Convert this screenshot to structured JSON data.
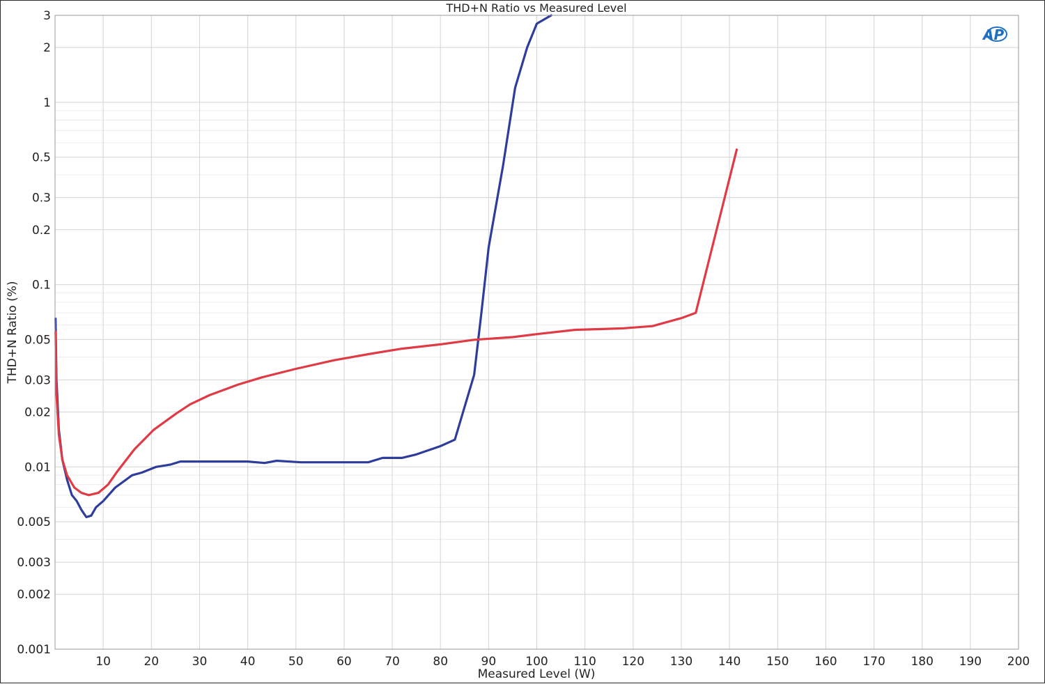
{
  "chart_data": {
    "type": "line",
    "title": "THD+N Ratio vs Measured Level",
    "xlabel": "Measured Level (W)",
    "ylabel": "THD+N Ratio (%)",
    "xlim": [
      0,
      200
    ],
    "ylim": [
      0.001,
      3
    ],
    "yscale": "log",
    "grid": true,
    "x_ticks": [
      10,
      20,
      30,
      40,
      50,
      60,
      70,
      80,
      90,
      100,
      110,
      120,
      130,
      140,
      150,
      160,
      170,
      180,
      190,
      200
    ],
    "y_ticks": [
      0.001,
      0.002,
      0.003,
      0.005,
      0.01,
      0.02,
      0.03,
      0.05,
      0.1,
      0.2,
      0.3,
      0.5,
      1,
      2,
      3
    ],
    "y_tick_labels": [
      "0.001",
      "0.002",
      "0.003",
      "0.005",
      "0.01",
      "0.02",
      "0.03",
      "0.05",
      "0.1",
      "0.2",
      "0.3",
      "0.5",
      "1",
      "2",
      "3"
    ],
    "series": [
      {
        "color": "#2e3c9c",
        "points": [
          [
            0.1,
            0.065
          ],
          [
            0.3,
            0.03
          ],
          [
            0.8,
            0.016
          ],
          [
            1.5,
            0.011
          ],
          [
            2.5,
            0.0085
          ],
          [
            3.5,
            0.007
          ],
          [
            4.5,
            0.0065
          ],
          [
            5.5,
            0.0058
          ],
          [
            6.5,
            0.0053
          ],
          [
            7.5,
            0.0054
          ],
          [
            8.5,
            0.006
          ],
          [
            10,
            0.0065
          ],
          [
            12.5,
            0.0077
          ],
          [
            16,
            0.009
          ],
          [
            18,
            0.0093
          ],
          [
            21,
            0.01
          ],
          [
            24,
            0.0103
          ],
          [
            26,
            0.0107
          ],
          [
            30,
            0.0107
          ],
          [
            35,
            0.0107
          ],
          [
            40,
            0.0107
          ],
          [
            43.5,
            0.0105
          ],
          [
            46,
            0.0108
          ],
          [
            51,
            0.0106
          ],
          [
            58,
            0.0106
          ],
          [
            65,
            0.0106
          ],
          [
            68,
            0.0112
          ],
          [
            72,
            0.0112
          ],
          [
            75,
            0.0117
          ],
          [
            80,
            0.013
          ],
          [
            83,
            0.0141
          ],
          [
            87,
            0.032
          ],
          [
            88.5,
            0.07
          ],
          [
            90,
            0.16
          ],
          [
            93,
            0.45
          ],
          [
            95.5,
            1.2
          ],
          [
            98,
            2.0
          ],
          [
            100,
            2.7
          ],
          [
            103,
            3.0
          ]
        ]
      },
      {
        "color": "#e03a44",
        "points": [
          [
            0.1,
            0.055
          ],
          [
            0.3,
            0.025
          ],
          [
            0.8,
            0.015
          ],
          [
            1.5,
            0.011
          ],
          [
            2.5,
            0.009
          ],
          [
            4,
            0.0077
          ],
          [
            5.5,
            0.0072
          ],
          [
            7,
            0.007
          ],
          [
            9,
            0.0072
          ],
          [
            11,
            0.008
          ],
          [
            13,
            0.0095
          ],
          [
            16.5,
            0.0125
          ],
          [
            20.5,
            0.016
          ],
          [
            25,
            0.0195
          ],
          [
            28,
            0.022
          ],
          [
            32,
            0.0247
          ],
          [
            38,
            0.0283
          ],
          [
            43,
            0.031
          ],
          [
            50,
            0.0345
          ],
          [
            58,
            0.0385
          ],
          [
            65,
            0.0415
          ],
          [
            72,
            0.0445
          ],
          [
            80,
            0.047
          ],
          [
            87,
            0.0498
          ],
          [
            95,
            0.0515
          ],
          [
            100,
            0.0535
          ],
          [
            108,
            0.0565
          ],
          [
            113,
            0.057
          ],
          [
            118,
            0.0576
          ],
          [
            124,
            0.0592
          ],
          [
            130,
            0.0655
          ],
          [
            133,
            0.07
          ],
          [
            141.5,
            0.55
          ]
        ]
      }
    ]
  },
  "logo_text": "AP"
}
